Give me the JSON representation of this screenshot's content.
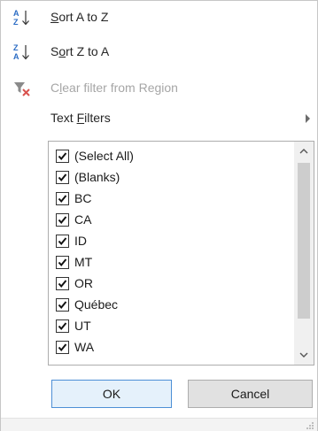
{
  "menu": {
    "sort_az": {
      "label_pre": "",
      "label_ul": "S",
      "label_post": "ort A to Z"
    },
    "sort_za": {
      "label_pre": "S",
      "label_ul": "o",
      "label_post": "rt Z to A"
    },
    "clear_filter": {
      "label_pre": "C",
      "label_ul": "l",
      "label_post": "ear filter from Region"
    },
    "text_filters": {
      "label_pre": "Text ",
      "label_ul": "F",
      "label_post": "ilters"
    }
  },
  "list": {
    "items": [
      {
        "label": "(Select All)",
        "checked": true
      },
      {
        "label": "(Blanks)",
        "checked": true
      },
      {
        "label": "BC",
        "checked": true
      },
      {
        "label": "CA",
        "checked": true
      },
      {
        "label": "ID",
        "checked": true
      },
      {
        "label": "MT",
        "checked": true
      },
      {
        "label": "OR",
        "checked": true
      },
      {
        "label": "Québec",
        "checked": true
      },
      {
        "label": "UT",
        "checked": true
      },
      {
        "label": "WA",
        "checked": true
      }
    ]
  },
  "buttons": {
    "ok": "OK",
    "cancel": "Cancel"
  },
  "colors": {
    "accent": "#2b6cc4",
    "sort_red": "#c0392b",
    "ok_border": "#4d8fd6"
  }
}
